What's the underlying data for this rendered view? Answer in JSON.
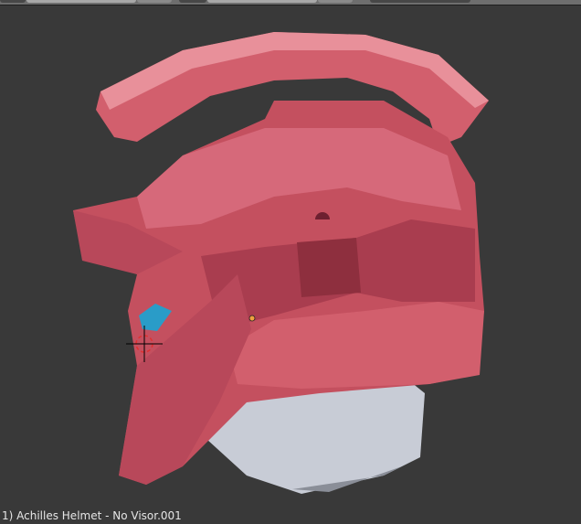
{
  "viewport": {
    "object_label": "1) Achilles Helmet - No Visor.001",
    "colors": {
      "background": "#393939",
      "helmet": "#c4505f",
      "helmet_light": "#e07884",
      "helmet_dark": "#8e2f3e",
      "neck": "#c8ccd6",
      "eye": "#2a9cc8"
    }
  },
  "icons": {
    "cursor": "3d-cursor-icon",
    "origin": "object-origin-icon"
  }
}
